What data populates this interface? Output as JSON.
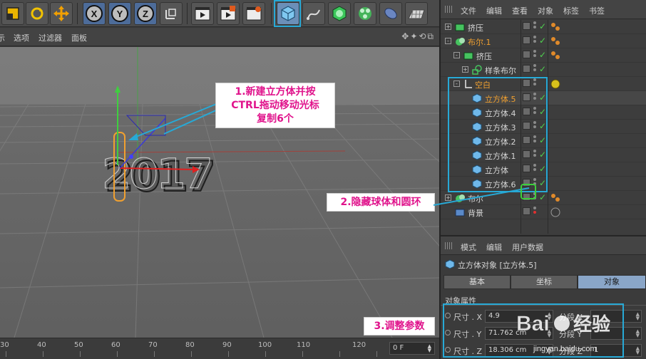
{
  "toolbar": {
    "axis_x": "X",
    "axis_y": "Y",
    "axis_z": "Z"
  },
  "viewport_menu": {
    "item_cut": "示",
    "options": "选项",
    "filter": "过滤器",
    "panel": "面板"
  },
  "viewport_text": "2017",
  "annotations": {
    "step1_line1": "1.新建立方体并按",
    "step1_line2": "CTRL拖动移动光标",
    "step1_line3": "复制6个",
    "step2": "2.隐藏球体和圆环",
    "step3": "3.调整参数"
  },
  "timeline": {
    "ticks": [
      "30",
      "40",
      "50",
      "60",
      "70",
      "80",
      "90",
      "100",
      "110",
      "120"
    ],
    "frame_value": "0 F"
  },
  "object_manager": {
    "menu": [
      "文件",
      "编辑",
      "查看",
      "对象",
      "标签",
      "书签"
    ],
    "items": [
      {
        "label": "挤压",
        "color": "normal",
        "check": true
      },
      {
        "label": "布尔.1",
        "color": "orange",
        "check": true
      },
      {
        "label": "挤压",
        "color": "normal",
        "check": true
      },
      {
        "label": "样条布尔",
        "color": "normal",
        "check": true
      },
      {
        "label": "空白",
        "color": "orange",
        "check": false
      },
      {
        "label": "立方体.5",
        "color": "orange",
        "check": true
      },
      {
        "label": "立方体.4",
        "color": "normal",
        "check": true
      },
      {
        "label": "立方体.3",
        "color": "normal",
        "check": true
      },
      {
        "label": "立方体.2",
        "color": "normal",
        "check": true
      },
      {
        "label": "立方体.1",
        "color": "normal",
        "check": true
      },
      {
        "label": "立方体",
        "color": "normal",
        "check": true
      },
      {
        "label": "立方体.6",
        "color": "normal",
        "check": true
      },
      {
        "label": "布尔",
        "color": "normal",
        "check": true
      },
      {
        "label": "背景",
        "color": "normal",
        "check": false
      }
    ]
  },
  "attributes": {
    "menu": [
      "模式",
      "编辑",
      "用户数据"
    ],
    "title": "立方体对象 [立方体.5]",
    "tabs": [
      "基本",
      "坐标",
      "对象"
    ],
    "active_tab": "对象",
    "section": "对象属性",
    "params": [
      {
        "label": "尺寸 . X",
        "value": "4.9",
        "seg_label": "分段 X",
        "seg_value": ""
      },
      {
        "label": "尺寸 . Y",
        "value": "71.762 cm",
        "seg_label": "分段 Y",
        "seg_value": ""
      },
      {
        "label": "尺寸 . Z",
        "value": "18.306 cm",
        "seg_label": "分段 Z",
        "seg_value": "1"
      }
    ]
  },
  "watermark": {
    "brand": "Baidu经验",
    "url": "jingyan.baidu.com"
  },
  "colors": {
    "highlight": "#27a9d6",
    "annotation_text": "#e0148c",
    "selected_label": "#f0a030",
    "check_green": "#4fd14f"
  }
}
